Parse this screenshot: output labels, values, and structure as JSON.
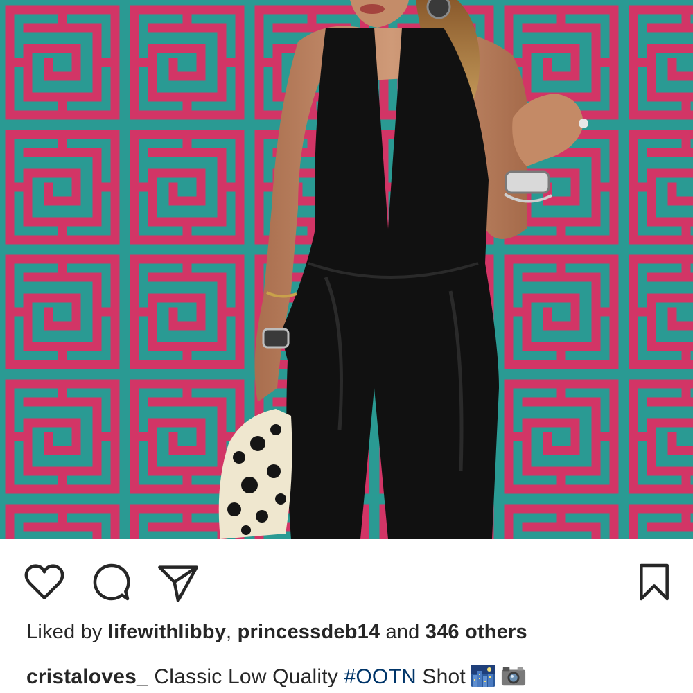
{
  "post": {
    "image_alt": "",
    "likes": {
      "prefix": "Liked by ",
      "user1": "lifewithlibby",
      "sep": ", ",
      "user2": "princessdeb14",
      "and": " and ",
      "others": "346 others"
    },
    "caption": {
      "username": "cristaloves_",
      "text_before": " Classic Low Quality ",
      "hashtag": "#OOTN",
      "text_after": " Shot",
      "emojis": [
        "night-city-emoji",
        "camera-emoji"
      ]
    }
  },
  "actions": {
    "icons": [
      "heart-icon",
      "comment-icon",
      "share-icon",
      "bookmark-icon"
    ]
  },
  "colors": {
    "text": "#262626",
    "hashtag": "#003569",
    "wall_teal": "#2a9a93",
    "wall_pink": "#d23566",
    "outfit_black": "#111111"
  }
}
